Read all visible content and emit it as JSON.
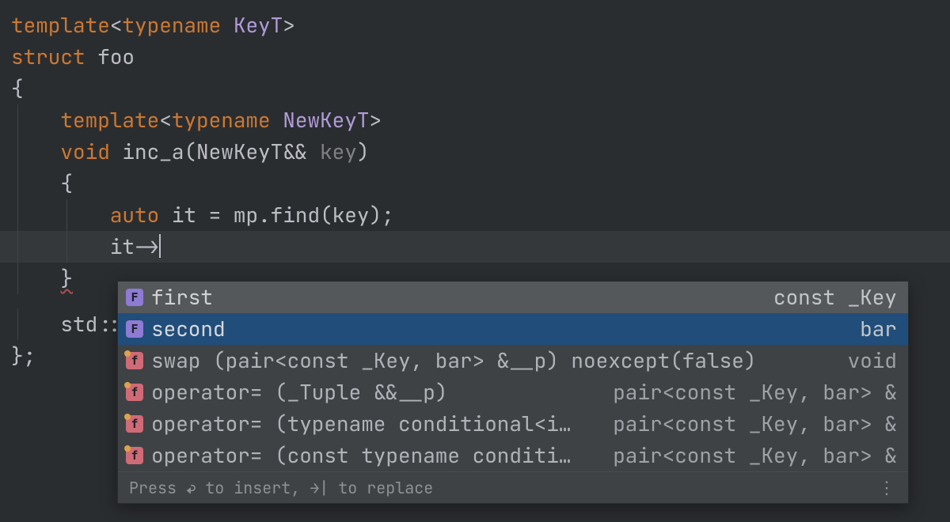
{
  "code": {
    "l1": {
      "kw1": "template",
      "kw2": "typename",
      "ty": "KeyT"
    },
    "l2": {
      "kw": "struct",
      "name": "foo"
    },
    "l3": {
      "brace": "{"
    },
    "l4": {
      "kw1": "template",
      "kw2": "typename",
      "ty": "NewKeyT"
    },
    "l5": {
      "kw": "void",
      "fn": "inc_a",
      "arg_ty": "NewKeyT",
      "arg_ref": "&&",
      "arg_name": "key"
    },
    "l6": {
      "brace": "{"
    },
    "l7": {
      "kw": "auto",
      "var": "it",
      "eq": "=",
      "obj": "mp",
      "fn": "find",
      "arg": "key"
    },
    "l8": {
      "var": "it",
      "arrow": "->"
    },
    "l9": {
      "brace": "}"
    },
    "l10": {
      "ns": "std",
      "scope": "::"
    },
    "l11": {
      "close": "};"
    }
  },
  "popup": {
    "items": [
      {
        "kind": "field",
        "icon": "F",
        "label": "first",
        "type": "const _Key",
        "state": "hover"
      },
      {
        "kind": "field",
        "icon": "F",
        "label": "second",
        "type": "bar",
        "state": "select"
      },
      {
        "kind": "method",
        "icon": "f",
        "label": "swap (pair<const _Key, bar> &__p) noexcept(false)",
        "type": "void"
      },
      {
        "kind": "method",
        "icon": "f",
        "label": "operator= (_Tuple &&__p)",
        "type": "pair<const _Key, bar> &"
      },
      {
        "kind": "method",
        "icon": "f",
        "label": "operator= (typename conditional<i…",
        "type": "pair<const _Key, bar> &"
      },
      {
        "kind": "method",
        "icon": "f",
        "label": "operator= (const typename conditi…",
        "type": "pair<const _Key, bar> &"
      }
    ],
    "hint_prefix": "Press ",
    "hint_insert_key": "↩",
    "hint_mid": " to insert, ",
    "hint_replace_key": "→|",
    "hint_suffix": " to replace",
    "more": "⋮"
  }
}
